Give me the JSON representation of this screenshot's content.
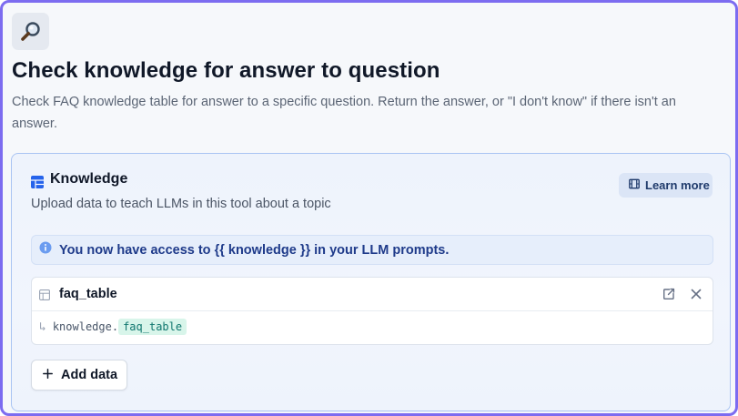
{
  "tool": {
    "icon": "magnifying-glass-icon",
    "title": "Check knowledge for answer to question",
    "description": "Check FAQ knowledge table for answer to a specific question. Return the answer, or \"I don't know\" if there isn't an answer."
  },
  "knowledge": {
    "icon": "grid-icon",
    "title": "Knowledge",
    "subtitle": "Upload data to teach LLMs in this tool about a topic",
    "learn_more": {
      "icon": "film-icon",
      "label": "Learn more"
    },
    "notice": {
      "icon": "info-icon",
      "text": "You now have access to {{ knowledge }} in your LLM prompts."
    },
    "data_item": {
      "icon": "table-icon",
      "name": "faq_table",
      "path_prefix": "knowledge.",
      "path_key": "faq_table",
      "arrow": "↳"
    },
    "add_data_label": "Add data"
  },
  "colors": {
    "frame_border": "#7c6cf0",
    "card_border": "#a9c4f3",
    "notice_text": "#1e3a8a",
    "chip_bg": "#d8f5ea",
    "chip_text": "#0f766e",
    "grid_icon": "#2563eb"
  }
}
